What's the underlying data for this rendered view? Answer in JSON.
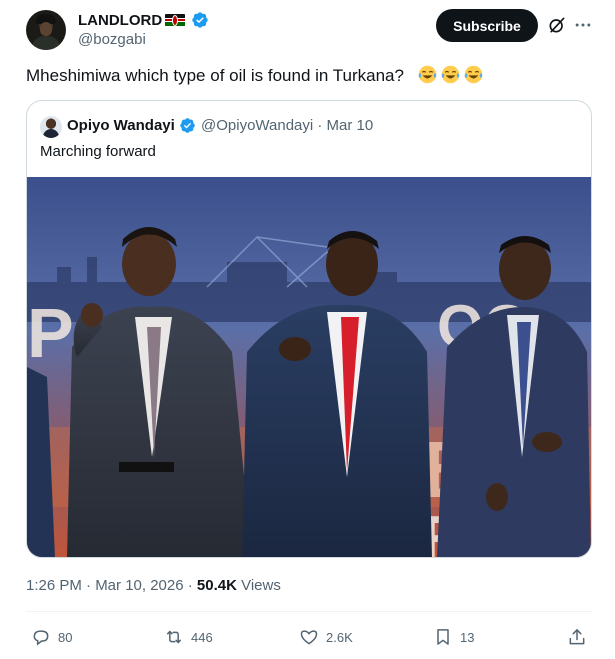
{
  "tweet": {
    "author_name": "LANDLORD",
    "author_handle": "@bozgabi",
    "subscribe_label": "Subscribe",
    "text": "Mheshimiwa which type of oil is found in Turkana?",
    "emojis": [
      "laugh-crying-icon",
      "laugh-crying-icon",
      "laugh-crying-icon"
    ],
    "flag": "kenya-flag-icon"
  },
  "quote": {
    "author_name": "Opiyo Wandayi",
    "handle_date": "@OpiyoWandayi · Mar 10",
    "text": "Marching forward"
  },
  "meta": {
    "time_date": "1:26 PM · Mar 10, 2026 · ",
    "views_count": "50.4K",
    "views_label": " Views"
  },
  "actions": {
    "replies": "80",
    "reposts": "446",
    "likes": "2.6K",
    "bookmarks": "13"
  },
  "colors": {
    "verified": "#1d9bf0",
    "text_primary": "#0f1419",
    "text_secondary": "#536471",
    "border": "#cfd9de",
    "button_bg": "#0f1419"
  }
}
